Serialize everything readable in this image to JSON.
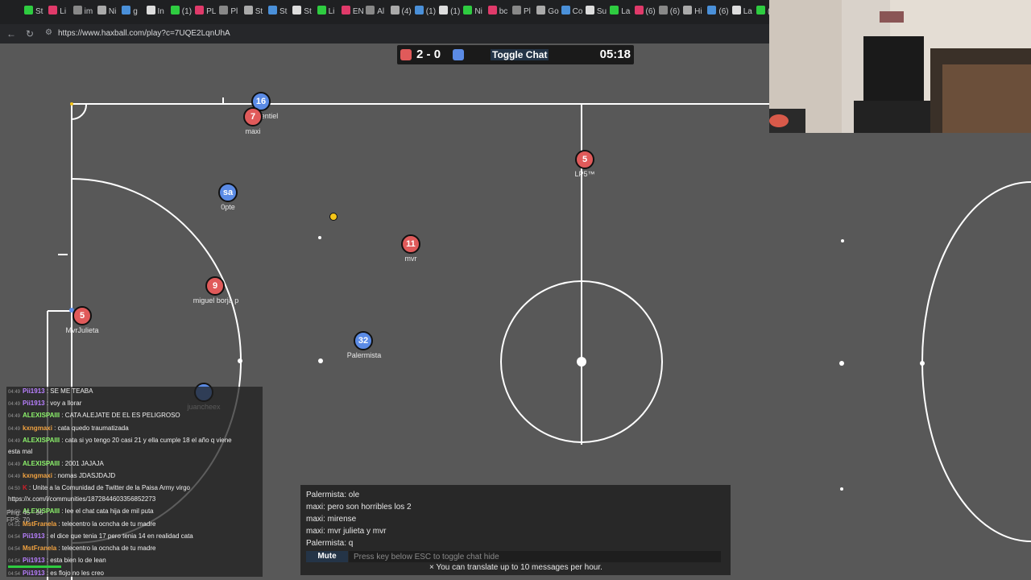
{
  "browser": {
    "tabs": [
      "St",
      "Li",
      "im",
      "Ni",
      "g",
      "In",
      "(1)",
      "PL",
      "Pl",
      "St",
      "St",
      "St",
      "Li",
      "EN",
      "Al",
      "(4)",
      "(1)",
      "(1)",
      "Ni",
      "bc",
      "Pl",
      "Go",
      "Co",
      "Su",
      "La",
      "(6)",
      "(6)",
      "Hi",
      "(6)",
      "La",
      "(2"
    ],
    "url": "https://www.haxball.com/play?c=7UQE2LqnUhA"
  },
  "scoreboard": {
    "red_score": "2",
    "separator": "-",
    "blue_score": "0",
    "toggle_chat": "Toggle Chat",
    "time": "05:18",
    "red_color": "#e05a5a",
    "blue_color": "#5b8be5"
  },
  "players": [
    {
      "number": "16",
      "name": "maxentiel",
      "team": "blue"
    },
    {
      "number": "7",
      "name": "maxi",
      "team": "red"
    },
    {
      "number": "5",
      "name": "LP5™",
      "team": "red"
    },
    {
      "number": "sa",
      "name": "0pte",
      "team": "blue"
    },
    {
      "number": "11",
      "name": "mvr",
      "team": "red"
    },
    {
      "number": "9",
      "name": "miguel borja p",
      "team": "red"
    },
    {
      "number": "5",
      "name": "MvrJulieta",
      "team": "red"
    },
    {
      "number": "32",
      "name": "Palermista",
      "team": "blue"
    },
    {
      "number": "",
      "name": "juancheex",
      "team": "blue"
    }
  ],
  "twitch_chat": [
    {
      "time": "04:49",
      "user": "Pii1913",
      "text": ": SE ME TEABA",
      "color": "#b980ff"
    },
    {
      "time": "04:49",
      "user": "Pii1913",
      "text": ": voy a llorar",
      "color": "#b980ff"
    },
    {
      "time": "04:49",
      "user": "ALEXISPAIII",
      "text": ": CATA ALEJATE DE EL ES PELIGROSO",
      "color": "#8cf26b"
    },
    {
      "time": "04:49",
      "user": "kxngmaxi",
      "text": ": cata quedo traumatizada",
      "color": "#f2a341"
    },
    {
      "time": "04:49",
      "user": "ALEXISPAIII",
      "text": ": cata si yo tengo 20 casi 21 y ella cumple 18 el año q viene",
      "color": "#8cf26b"
    },
    {
      "time": "",
      "user": "",
      "text": "esta mal",
      "color": "#f0f0f0"
    },
    {
      "time": "04:49",
      "user": "ALEXISPAIII",
      "text": ": 2001 JAJAJA",
      "color": "#8cf26b"
    },
    {
      "time": "04:49",
      "user": "kxngmaxi",
      "text": ": nomas JDASJDAJD",
      "color": "#f2a341"
    },
    {
      "time": "04:50",
      "user": "K",
      "text": ": Unite a la Comunidad de Twitter de la Paisa Army virgo",
      "color": "#d0202a"
    },
    {
      "time": "",
      "user": "",
      "text": "https://x.com/i/communities/1872844603356852273",
      "color": "#f0f0f0"
    },
    {
      "time": "04:50",
      "user": "ALEXISPAIII",
      "text": ": lee el chat cata hija de mil puta",
      "color": "#8cf26b"
    },
    {
      "time": "04:51",
      "user": "MstFranela",
      "text": ": telecentro la ocncha de tu madre",
      "color": "#f2a341"
    },
    {
      "time": "04:54",
      "user": "Pii1913",
      "text": ": el dice que tenia 17 pero tenia 14 en realidad cata",
      "color": "#b980ff"
    },
    {
      "time": "04:54",
      "user": "MstFranela",
      "text": ": telecentro la ocncha de tu madre",
      "color": "#f2a341"
    },
    {
      "time": "04:54",
      "user": "Pii1913",
      "text": ": esta bien lo de lean",
      "color": "#b980ff"
    },
    {
      "time": "04:54",
      "user": "Pii1913",
      "text": ": es flojo no les creo",
      "color": "#b980ff"
    }
  ],
  "ping_text": "Ping: 45 - 96",
  "fps_text": "FPS: 70",
  "game_chat": {
    "messages": [
      "Palermista: ole",
      "maxi: pero son horribles los 2",
      "maxi: mirense",
      "maxi: mvr julieta y mvr",
      "Palermista: q"
    ],
    "mute_label": "Mute",
    "input_placeholder": "Press key below ESC to toggle chat hide",
    "notice": "× You can translate up to 10 messages per hour."
  }
}
